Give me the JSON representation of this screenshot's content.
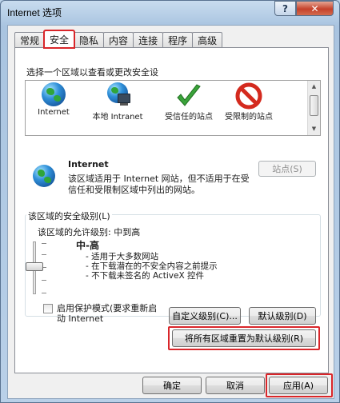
{
  "window": {
    "title": "Internet 选项",
    "help_label": "?",
    "close_label": "✕"
  },
  "tabs": [
    {
      "label": "常规"
    },
    {
      "label": "安全"
    },
    {
      "label": "隐私"
    },
    {
      "label": "内容"
    },
    {
      "label": "连接"
    },
    {
      "label": "程序"
    },
    {
      "label": "高级"
    }
  ],
  "security": {
    "zone_prompt": "选择一个区域以查看或更改安全设",
    "zones": [
      {
        "label": "Internet",
        "icon": "globe-icon"
      },
      {
        "label": "本地 Intranet",
        "icon": "intranet-icon"
      },
      {
        "label": "受信任的站点",
        "icon": "check-icon"
      },
      {
        "label": "受限制的站点",
        "icon": "restricted-icon"
      }
    ],
    "selected_zone": {
      "name": "Internet",
      "description": "该区域适用于 Internet 网站，但不适用于在受信任和受限制区域中列出的网站。",
      "sites_button": "站点(S)"
    },
    "level": {
      "group_title": "该区域的安全级别(L)",
      "allowed_label": "该区域的允许级别: 中到高",
      "level_name": "中-高",
      "bullets": [
        "- 适用于大多数网站",
        "- 在下载潜在的不安全内容之前提示",
        "- 不下载未签名的 ActiveX 控件"
      ]
    },
    "protected_mode_label": "启用保护模式(要求重新启动 Internet",
    "custom_level_button": "自定义级别(C)...",
    "default_level_button": "默认级别(D)",
    "reset_all_button": "将所有区域重置为默认级别(R)"
  },
  "footer": {
    "ok": "确定",
    "cancel": "取消",
    "apply": "应用(A)"
  },
  "colors": {
    "highlight_red": "#d9262a",
    "titlebar": "#a9c4e0"
  }
}
